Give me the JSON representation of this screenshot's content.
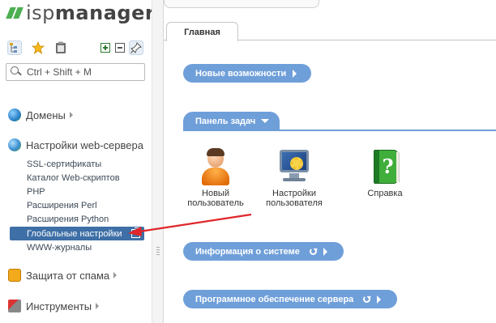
{
  "logo": {
    "text_light": "isp",
    "text_bold": "manager"
  },
  "toolbar": {
    "tree_icon": "tree-view-icon",
    "star_icon": "star-icon",
    "clipboard_icon": "clipboard-icon",
    "plus_icon": "expand-all-icon",
    "minus_icon": "collapse-all-icon",
    "pin_icon": "pin-icon"
  },
  "search": {
    "placeholder": "Ctrl + Shift + M"
  },
  "sidebar": {
    "groups": [
      {
        "label": "Домены",
        "icon": "globe-icon"
      },
      {
        "label": "Настройки web-сервера",
        "icon": "globe-gear-icon"
      },
      {
        "label": "Защита от спама",
        "icon": "shield-icon"
      },
      {
        "label": "Инструменты",
        "icon": "tools-icon"
      }
    ],
    "web_items": [
      "SSL-сертификаты",
      "Каталог Web-скриптов",
      "PHP",
      "Расширения Perl",
      "Расширения Python",
      "Глобальные настройки",
      "WWW-журналы"
    ],
    "active_item_index": 5,
    "active_color": "#3e6fa6"
  },
  "main": {
    "tab_label": "Главная",
    "features_label": "Новые возможности",
    "taskpanel_label": "Панель задач",
    "sysinfo_label": "Информация о системе",
    "software_label": "Программное обеспечение сервера",
    "accent_color": "#6f9fd9",
    "tiles": [
      {
        "line1": "Новый",
        "line2": "пользователь",
        "icon": "new-user-icon"
      },
      {
        "line1": "Настройки",
        "line2": "пользователя",
        "icon": "user-settings-icon"
      },
      {
        "line1": "Справка",
        "line2": "",
        "icon": "help-book-icon"
      }
    ]
  },
  "annotation": {
    "arrow_color": "#e0262a"
  }
}
